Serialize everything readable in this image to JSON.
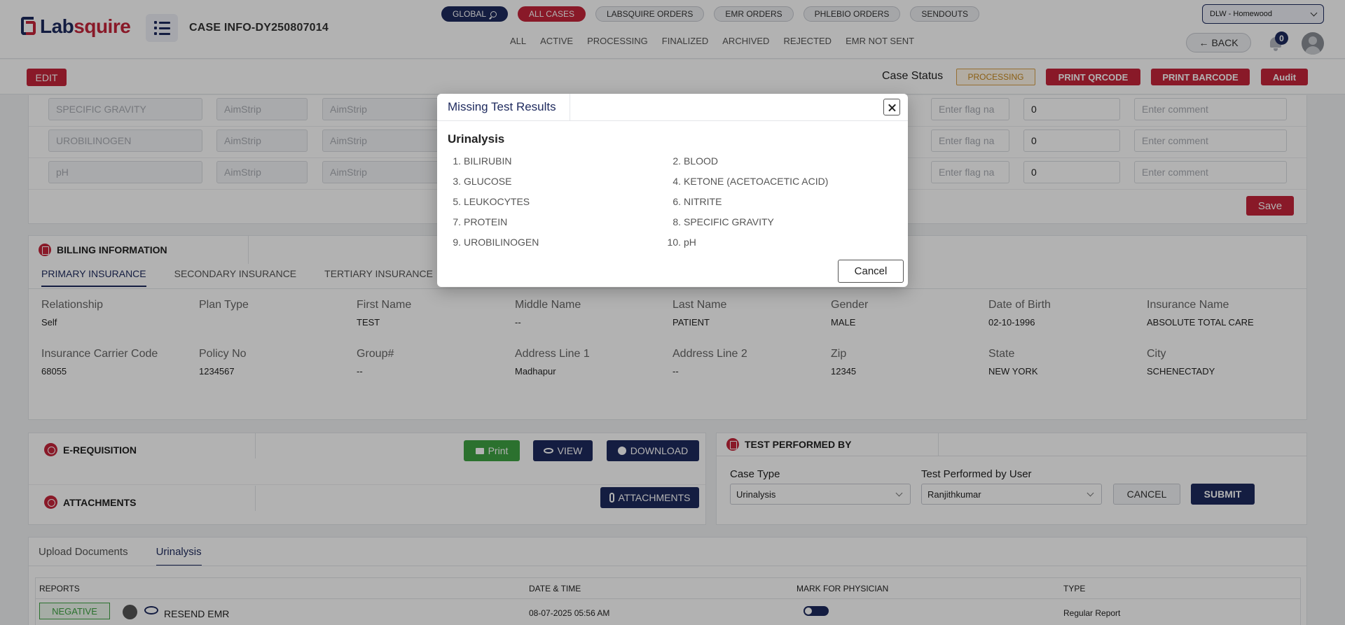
{
  "header": {
    "brand_part1": "Lab",
    "brand_part2": "squire",
    "case_title": "CASE INFO-DY250807014",
    "pills": [
      "GLOBAL",
      "ALL CASES",
      "LABSQUIRE ORDERS",
      "EMR ORDERS",
      "PHLEBIO ORDERS",
      "SENDOUTS"
    ],
    "subtabs": [
      "ALL",
      "ACTIVE",
      "PROCESSING",
      "FINALIZED",
      "ARCHIVED",
      "REJECTED",
      "EMR NOT SENT"
    ],
    "location": "DLW - Homewood",
    "back_label": "BACK",
    "notification_count": "0"
  },
  "actionbar": {
    "edit_label": "EDIT",
    "case_status_label": "Case Status",
    "status_value": "PROCESSING",
    "print_qrcode": "PRINT QRCODE",
    "print_barcode": "PRINT BARCODE",
    "audit": "Audit"
  },
  "results": {
    "rows": [
      {
        "test": "SPECIFIC GRAVITY",
        "method1": "AimStrip",
        "method2": "AimStrip",
        "flag": "Enter flag na",
        "value": "0",
        "comment": "Enter comment"
      },
      {
        "test": "UROBILINOGEN",
        "method1": "AimStrip",
        "method2": "AimStrip",
        "flag": "Enter flag na",
        "value": "0",
        "comment": "Enter comment"
      },
      {
        "test": "pH",
        "method1": "AimStrip",
        "method2": "AimStrip",
        "flag": "Enter flag na",
        "value": "0",
        "comment": "Enter comment"
      }
    ],
    "save_label": "Save"
  },
  "billing": {
    "title": "BILLING INFORMATION",
    "tabs": [
      "PRIMARY INSURANCE",
      "SECONDARY INSURANCE",
      "TERTIARY INSURANCE"
    ],
    "row1": [
      {
        "k": "Relationship",
        "v": "Self"
      },
      {
        "k": "Plan Type",
        "v": ""
      },
      {
        "k": "First Name",
        "v": "TEST"
      },
      {
        "k": "Middle Name",
        "v": "--"
      },
      {
        "k": "Last Name",
        "v": "PATIENT"
      },
      {
        "k": "Gender",
        "v": "MALE"
      },
      {
        "k": "Date of Birth",
        "v": "02-10-1996"
      },
      {
        "k": "Insurance Name",
        "v": "ABSOLUTE TOTAL CARE"
      }
    ],
    "row2": [
      {
        "k": "Insurance Carrier Code",
        "v": "68055"
      },
      {
        "k": "Policy No",
        "v": "1234567"
      },
      {
        "k": "Group#",
        "v": "--"
      },
      {
        "k": "Address Line 1",
        "v": "Madhapur"
      },
      {
        "k": "Address Line 2",
        "v": "--"
      },
      {
        "k": "Zip",
        "v": "12345"
      },
      {
        "k": "State",
        "v": "NEW YORK"
      },
      {
        "k": "City",
        "v": "SCHENECTADY"
      }
    ]
  },
  "ereq": {
    "title": "E-REQUISITION",
    "print": "Print",
    "view": "VIEW",
    "download": "DOWNLOAD",
    "attachments_title": "ATTACHMENTS",
    "attachments_btn": "ATTACHMENTS"
  },
  "tpb": {
    "title": "TEST PERFORMED BY",
    "case_type_label": "Case Type",
    "case_type_value": "Urinalysis",
    "user_label": "Test Performed by User",
    "user_value": "Ranjithkumar",
    "cancel": "CANCEL",
    "submit": "SUBMIT"
  },
  "reports": {
    "tabs": [
      "Upload Documents",
      "Urinalysis"
    ],
    "columns": [
      "REPORTS",
      "DATE & TIME",
      "MARK FOR PHYSICIAN",
      "TYPE"
    ],
    "row": {
      "result": "NEGATIVE",
      "action": "RESEND EMR",
      "datetime": "08-07-2025 05:56 AM",
      "type": "Regular Report"
    }
  },
  "modal": {
    "title": "Missing Test Results",
    "section": "Urinalysis",
    "items": [
      {
        "n": "1.",
        "label": "BILIRUBIN"
      },
      {
        "n": "2.",
        "label": "BLOOD"
      },
      {
        "n": "3.",
        "label": "GLUCOSE"
      },
      {
        "n": "4.",
        "label": "KETONE (ACETOACETIC ACID)"
      },
      {
        "n": "5.",
        "label": "LEUKOCYTES"
      },
      {
        "n": "6.",
        "label": "NITRITE"
      },
      {
        "n": "7.",
        "label": "PROTEIN"
      },
      {
        "n": "8.",
        "label": "SPECIFIC GRAVITY"
      },
      {
        "n": "9.",
        "label": "UROBILINOGEN"
      },
      {
        "n": "10.",
        "label": "pH"
      }
    ],
    "cancel": "Cancel"
  }
}
